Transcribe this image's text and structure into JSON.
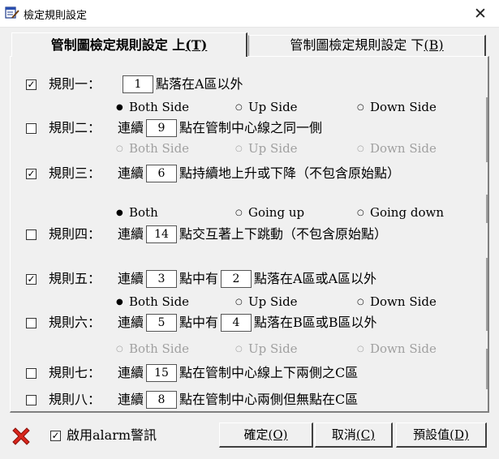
{
  "window": {
    "title": "檢定規則設定",
    "close_glyph": "✕"
  },
  "tabs": [
    {
      "label": "管制圖檢定規則設定 上",
      "hotkey": "(T)"
    },
    {
      "label": "管制圖檢定規則設定 下",
      "hotkey": "(B)"
    }
  ],
  "rules": [
    {
      "label": "規則一：",
      "checked": true,
      "parts": [
        {
          "t": "num",
          "v": "1"
        },
        {
          "t": "text",
          "v": "點落在A區以外"
        }
      ]
    },
    {
      "label": "規則二：",
      "checked": false,
      "parts": [
        {
          "t": "text",
          "v": "連續"
        },
        {
          "t": "num",
          "v": "9"
        },
        {
          "t": "text",
          "v": "點在管制中心線之同一側"
        }
      ]
    },
    {
      "label": "規則三：",
      "checked": true,
      "parts": [
        {
          "t": "text",
          "v": "連續"
        },
        {
          "t": "num",
          "v": "6"
        },
        {
          "t": "text",
          "v": "點持續地上升或下降（不包含原始點）"
        }
      ]
    },
    {
      "label": "規則四：",
      "checked": false,
      "parts": [
        {
          "t": "text",
          "v": "連續"
        },
        {
          "t": "num",
          "v": "14"
        },
        {
          "t": "text",
          "v": "點交互著上下跳動（不包含原始點）"
        }
      ]
    },
    {
      "label": "規則五：",
      "checked": true,
      "parts": [
        {
          "t": "text",
          "v": "連續"
        },
        {
          "t": "num",
          "v": "3"
        },
        {
          "t": "text",
          "v": "點中有"
        },
        {
          "t": "num",
          "v": "2"
        },
        {
          "t": "text",
          "v": "點落在A區或A區以外"
        }
      ]
    },
    {
      "label": "規則六：",
      "checked": false,
      "parts": [
        {
          "t": "text",
          "v": "連續"
        },
        {
          "t": "num",
          "v": "5"
        },
        {
          "t": "text",
          "v": "點中有"
        },
        {
          "t": "num",
          "v": "4"
        },
        {
          "t": "text",
          "v": "點落在B區或B區以外"
        }
      ]
    },
    {
      "label": "規則七：",
      "checked": false,
      "parts": [
        {
          "t": "text",
          "v": "連續"
        },
        {
          "t": "num",
          "v": "15"
        },
        {
          "t": "text",
          "v": "點在管制中心線上下兩側之C區"
        }
      ]
    },
    {
      "label": "規則八：",
      "checked": false,
      "parts": [
        {
          "t": "text",
          "v": "連續"
        },
        {
          "t": "num",
          "v": "8"
        },
        {
          "t": "text",
          "v": "點在管制中心兩側但無點在C區"
        }
      ]
    }
  ],
  "radio_groups": [
    {
      "enabled": true,
      "options": [
        "Both Side",
        "Up Side",
        "Down Side"
      ],
      "selected": 0
    },
    {
      "enabled": false,
      "options": [
        "Both Side",
        "Up Side",
        "Down Side"
      ],
      "selected": -1
    },
    {
      "enabled": true,
      "options": [
        "Both",
        "Going up",
        "Going down"
      ],
      "selected": 0
    },
    {
      "enabled": true,
      "options": [
        "Both Side",
        "Up Side",
        "Down Side"
      ],
      "selected": 0
    },
    {
      "enabled": false,
      "options": [
        "Both Side",
        "Up Side",
        "Down Side"
      ],
      "selected": -1
    }
  ],
  "bottom": {
    "alarm_checked": true,
    "alarm_label": "啟用alarm警訊",
    "buttons": [
      {
        "label": "確定",
        "hotkey": "(O)"
      },
      {
        "label": "取消",
        "hotkey": "(C)"
      },
      {
        "label": "預設值",
        "hotkey": "(D)"
      }
    ]
  },
  "colors": {
    "disabled_text": "#a0a0a0",
    "red_x": "#d9261c"
  }
}
